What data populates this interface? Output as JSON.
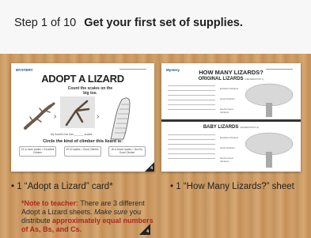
{
  "header": {
    "step": "Step 1 of 10",
    "title": "Get your first set of supplies."
  },
  "card1": {
    "logo": "MYSTERY",
    "title": "ADOPT A LIZARD",
    "subtitle": "Count the scales on the big toe.",
    "caption": "My lizard's toe has ______ scales.",
    "circle_text": "Circle the kind of climber this lizard is:",
    "options": [
      "23 or more scales = Excellent Climber",
      "19-22 scales = Good Climber",
      "18 or fewer scales = Not-So-Good Climber"
    ],
    "badge": "4"
  },
  "card2": {
    "logo": "Mystery",
    "title": "HOW MANY LIZARDS?",
    "section1": "ORIGINAL LIZARDS",
    "section1_gen": "(GENERATION 1)",
    "section2": "BABY LIZARDS",
    "section2_gen": "(GENERATION 2)",
    "rows": [
      "Excellent Climbers",
      "Good Climbers",
      "Not-So-Good Climbers"
    ]
  },
  "bullet1": "• 1 “Adopt a Lizard” card*",
  "bullet2": "• 1 “How Many Lizards?” sheet",
  "note": {
    "lead": "*Note to teacher:",
    "text1": " There are 3 different Adopt a Lizard sheets. ",
    "ital": "Make sure",
    "text2": " you distribute ",
    "bold": "approximately equal numbers of As, Bs, and Cs."
  },
  "note_badge": "4"
}
